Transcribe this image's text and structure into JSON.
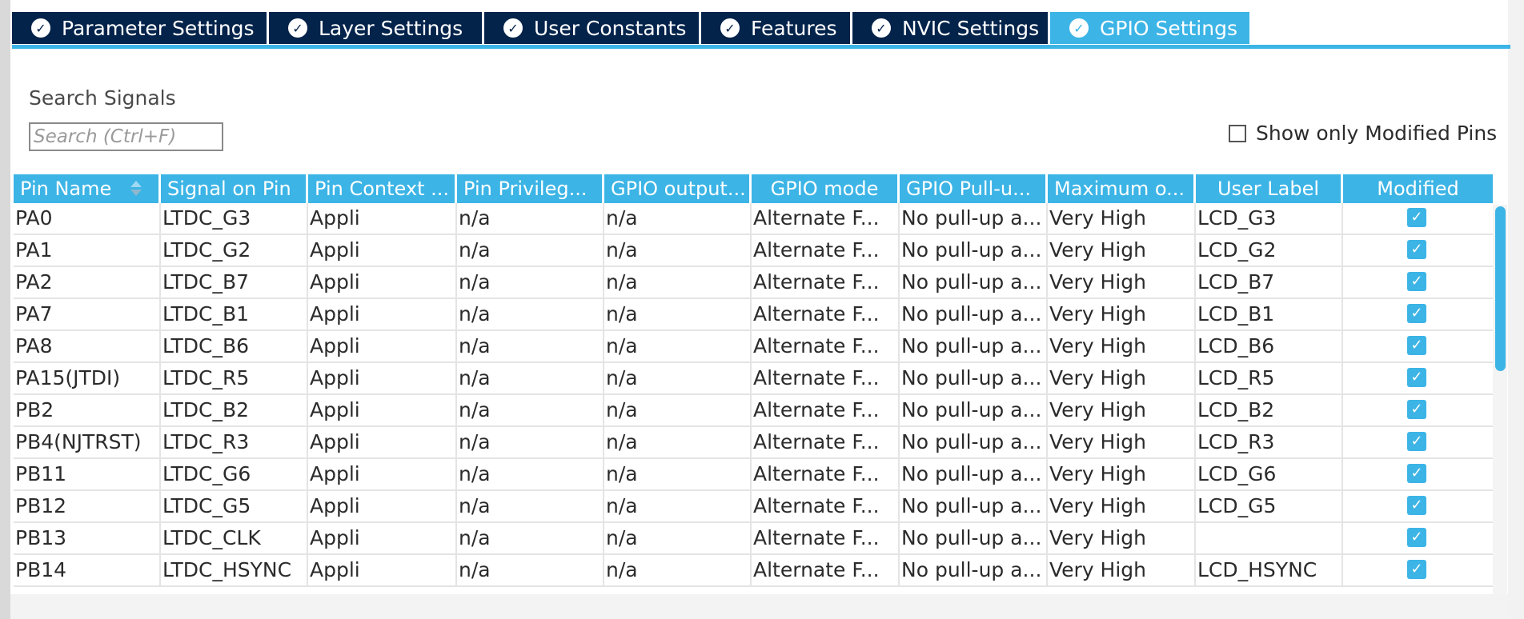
{
  "tabs": [
    {
      "label": "Parameter Settings",
      "active": false
    },
    {
      "label": "Layer Settings",
      "active": false
    },
    {
      "label": "User Constants",
      "active": false
    },
    {
      "label": "Features",
      "active": false
    },
    {
      "label": "NVIC Settings",
      "active": false
    },
    {
      "label": "GPIO Settings",
      "active": true
    }
  ],
  "search": {
    "label": "Search Signals",
    "placeholder": "Search (Ctrl+F)"
  },
  "filter": {
    "label": "Show only Modified Pins",
    "checked": false
  },
  "table": {
    "columns": [
      "Pin Name",
      "Signal on Pin",
      "Pin Context ...",
      "Pin Privileg...",
      "GPIO output...",
      "GPIO mode",
      "GPIO Pull-u...",
      "Maximum o...",
      "User Label",
      "Modified"
    ],
    "rows": [
      [
        "PA0",
        "LTDC_G3",
        "Appli",
        "n/a",
        "n/a",
        "Alternate F...",
        "No pull-up a...",
        "Very High",
        "LCD_G3"
      ],
      [
        "PA1",
        "LTDC_G2",
        "Appli",
        "n/a",
        "n/a",
        "Alternate F...",
        "No pull-up a...",
        "Very High",
        "LCD_G2"
      ],
      [
        "PA2",
        "LTDC_B7",
        "Appli",
        "n/a",
        "n/a",
        "Alternate F...",
        "No pull-up a...",
        "Very High",
        "LCD_B7"
      ],
      [
        "PA7",
        "LTDC_B1",
        "Appli",
        "n/a",
        "n/a",
        "Alternate F...",
        "No pull-up a...",
        "Very High",
        "LCD_B1"
      ],
      [
        "PA8",
        "LTDC_B6",
        "Appli",
        "n/a",
        "n/a",
        "Alternate F...",
        "No pull-up a...",
        "Very High",
        "LCD_B6"
      ],
      [
        "PA15(JTDI)",
        "LTDC_R5",
        "Appli",
        "n/a",
        "n/a",
        "Alternate F...",
        "No pull-up a...",
        "Very High",
        "LCD_R5"
      ],
      [
        "PB2",
        "LTDC_B2",
        "Appli",
        "n/a",
        "n/a",
        "Alternate F...",
        "No pull-up a...",
        "Very High",
        "LCD_B2"
      ],
      [
        "PB4(NJTRST)",
        "LTDC_R3",
        "Appli",
        "n/a",
        "n/a",
        "Alternate F...",
        "No pull-up a...",
        "Very High",
        "LCD_R3"
      ],
      [
        "PB11",
        "LTDC_G6",
        "Appli",
        "n/a",
        "n/a",
        "Alternate F...",
        "No pull-up a...",
        "Very High",
        "LCD_G6"
      ],
      [
        "PB12",
        "LTDC_G5",
        "Appli",
        "n/a",
        "n/a",
        "Alternate F...",
        "No pull-up a...",
        "Very High",
        "LCD_G5"
      ],
      [
        "PB13",
        "LTDC_CLK",
        "Appli",
        "n/a",
        "n/a",
        "Alternate F...",
        "No pull-up a...",
        "Very High",
        ""
      ],
      [
        "PB14",
        "LTDC_HSYNC",
        "Appli",
        "n/a",
        "n/a",
        "Alternate F...",
        "No pull-up a...",
        "Very High",
        "LCD_HSYNC"
      ]
    ],
    "modified": [
      true,
      true,
      true,
      true,
      true,
      true,
      true,
      true,
      true,
      true,
      true,
      true
    ]
  },
  "icons": {
    "tab_status": "check-circle-icon",
    "modified": "checkbox-checked-icon",
    "sort": "sort-icon"
  },
  "colors": {
    "tab_bg": "#03234b",
    "accent": "#3cb4e6",
    "text": "#2b2b2b"
  }
}
